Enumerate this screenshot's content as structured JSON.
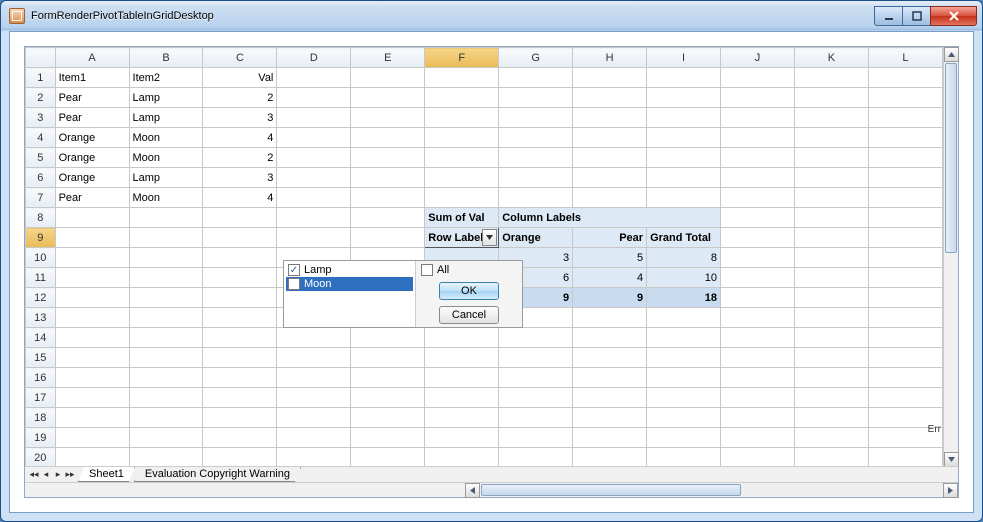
{
  "window": {
    "title": "FormRenderPivotTableInGridDesktop"
  },
  "columns": [
    "A",
    "B",
    "C",
    "D",
    "E",
    "F",
    "G",
    "H",
    "I",
    "J",
    "K",
    "L"
  ],
  "row_count": 20,
  "selected_col_index": 5,
  "selected_row_index": 9,
  "cells": {
    "A1": "Item1",
    "B1": "Item2",
    "C1": "Val",
    "A2": "Pear",
    "B2": "Lamp",
    "C2": "2",
    "A3": "Pear",
    "B3": "Lamp",
    "C3": "3",
    "A4": "Orange",
    "B4": "Moon",
    "C4": "4",
    "A5": "Orange",
    "B5": "Moon",
    "C5": "2",
    "A6": "Orange",
    "B6": "Lamp",
    "C6": "3",
    "A7": "Pear",
    "B7": "Moon",
    "C7": "4"
  },
  "pivot": {
    "sum_label": "Sum of Val",
    "column_labels_text": "Column Labels",
    "row_labels_text": "Row Labels",
    "col_headers": [
      "Orange",
      "Pear",
      "Grand Total"
    ],
    "row1": {
      "vals": [
        "3",
        "5",
        "8"
      ]
    },
    "row2": {
      "vals": [
        "6",
        "4",
        "10"
      ]
    },
    "total": {
      "vals": [
        "9",
        "9",
        "18"
      ]
    }
  },
  "filter": {
    "items": [
      {
        "label": "Lamp",
        "checked": true,
        "selected": false
      },
      {
        "label": "Moon",
        "checked": false,
        "selected": true
      }
    ],
    "all_label": "All",
    "all_checked": false,
    "ok_label": "OK",
    "cancel_label": "Cancel"
  },
  "tabs": {
    "active": "Sheet1",
    "inactive": "Evaluation Copyright Warning"
  },
  "err_text": "Err"
}
